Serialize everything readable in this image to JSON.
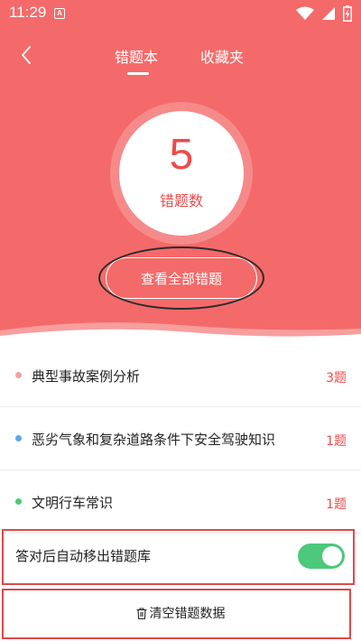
{
  "status_bar": {
    "time": "11:29",
    "notification_letter": "A"
  },
  "nav": {
    "tabs": [
      {
        "label": "错题本",
        "active": true
      },
      {
        "label": "收藏夹",
        "active": false
      }
    ]
  },
  "summary": {
    "count": "5",
    "label": "错题数",
    "view_all_label": "查看全部错题"
  },
  "categories": [
    {
      "title": "典型事故案例分析",
      "count": "3题",
      "dot_color": "#f3a0a0"
    },
    {
      "title": "恶劣气象和复杂道路条件下安全驾驶知识",
      "count": "1题",
      "dot_color": "#5aa8e8"
    },
    {
      "title": "文明行车常识",
      "count": "1题",
      "dot_color": "#4cc97a"
    }
  ],
  "settings": {
    "auto_remove_label": "答对后自动移出错题库",
    "auto_remove_enabled": true
  },
  "actions": {
    "clear_label": "清空错题数据"
  },
  "colors": {
    "accent": "#f46a6a",
    "count_red": "#ee4b4b",
    "toggle_on": "#4cc97a",
    "annotation_red": "#e04848"
  }
}
